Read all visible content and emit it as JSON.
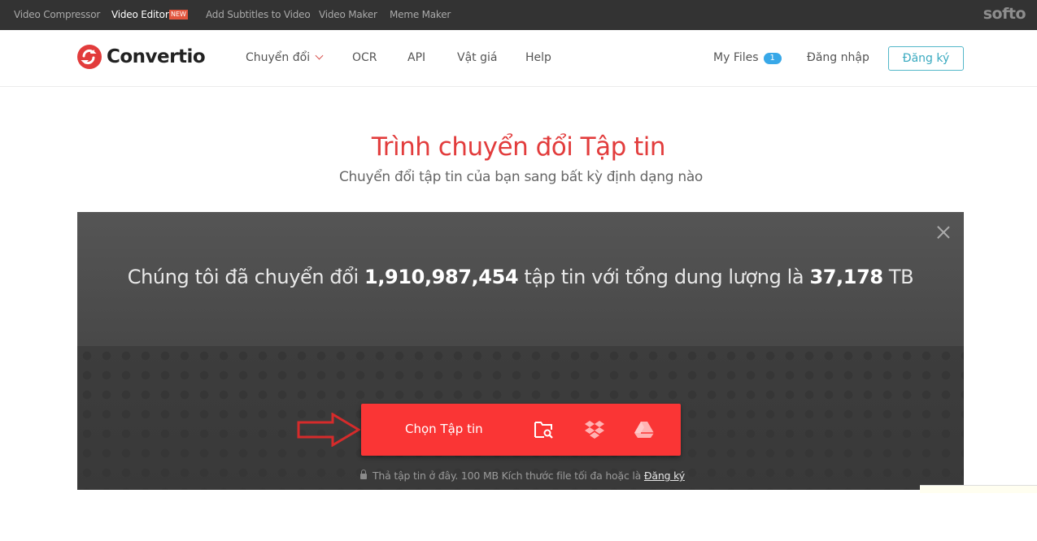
{
  "topbar": {
    "links": [
      {
        "label": "Video Compressor",
        "active": false
      },
      {
        "label": "Video Editor",
        "active": true,
        "badge": "NEW"
      },
      {
        "label": "Add Subtitles to Video",
        "active": false
      },
      {
        "label": "Video Maker",
        "active": false
      },
      {
        "label": "Meme Maker",
        "active": false
      }
    ],
    "brand": "softo"
  },
  "header": {
    "logo_text": "Convertio",
    "nav": [
      {
        "label": "Chuyển đổi",
        "has_dropdown": true
      },
      {
        "label": "OCR"
      },
      {
        "label": "API"
      },
      {
        "label": "Vật giá"
      },
      {
        "label": "Help"
      }
    ],
    "my_files_label": "My Files",
    "my_files_count": "1",
    "login_label": "Đăng nhập",
    "signup_label": "Đăng ký"
  },
  "hero": {
    "title": "Trình chuyển đổi Tập tin",
    "subtitle": "Chuyển đổi tập tin của bạn sang bất kỳ định dạng nào"
  },
  "stats": {
    "prefix": "Chúng tôi đã chuyển đổi",
    "files_count": "1,910,987,454",
    "middle": "tập tin với tổng dung lượng là",
    "total_size": "37,178",
    "unit": "TB"
  },
  "upload": {
    "choose_label": "Chọn Tập tin",
    "icons": [
      "folder-search-icon",
      "dropbox-icon",
      "google-drive-icon"
    ],
    "hint_text": "Thả tập tin ở đây. 100 MB Kích thước file tối đa hoặc là",
    "hint_link": "Đăng ký"
  },
  "colors": {
    "accent_red": "#fa3535",
    "title_red": "#e23c3c",
    "badge_blue": "#38a8e8",
    "signup_teal": "#3aaac0"
  }
}
